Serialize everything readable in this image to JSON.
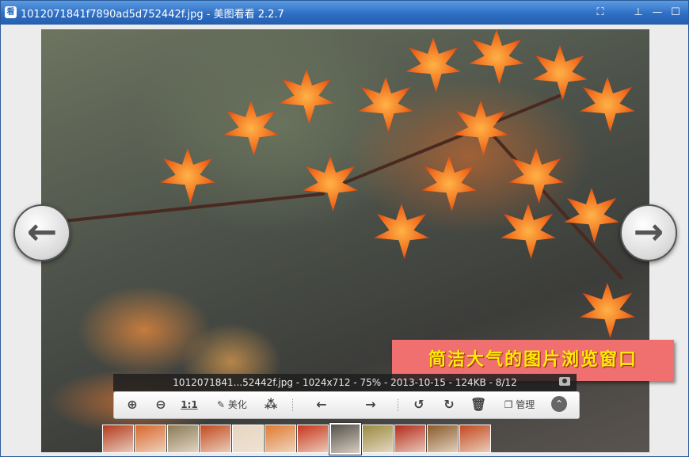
{
  "titlebar": {
    "app_icon": "看",
    "title": "1012071841f7890ad5d752442f.jpg - 美图看看 2.2.7",
    "buttons": [
      {
        "name": "fullscreen-icon",
        "glyph": "⛶"
      },
      {
        "name": "pin-icon",
        "glyph": "⊥"
      },
      {
        "name": "minimize-icon",
        "glyph": "—"
      },
      {
        "name": "maximize-icon",
        "glyph": "☐"
      },
      {
        "name": "close-icon",
        "glyph": "✕"
      }
    ]
  },
  "viewer": {
    "prev_arrow": "arrow-left-icon",
    "next_arrow": "arrow-right-icon",
    "caption_overlay": "简洁大气的图片浏览窗口"
  },
  "info_bar": {
    "text": "1012071841...52442f.jpg - 1024x712 - 75% - 2013-10-15 - 124KB - 8/12"
  },
  "toolbar": {
    "zoom_in": "⊕",
    "zoom_out": "⊖",
    "actual_size": "1:1",
    "beautify_label": "美化",
    "share": "share-icon",
    "prev": "←",
    "next": "→",
    "rotate_left": "↺",
    "rotate_right": "↻",
    "delete": "delete-icon",
    "manage_label": "管理",
    "collapse": "⌃"
  },
  "filmstrip": {
    "count": 12,
    "selected_index": 7,
    "thumbs": [
      "#b33a1c",
      "#d9662a",
      "#8a7a55",
      "#c24a1e",
      "#e5d4c0",
      "#e07a30",
      "#c8351a",
      "#54504a",
      "#9a8a40",
      "#b52a1a",
      "#8a5a2a",
      "#c2481e"
    ]
  }
}
